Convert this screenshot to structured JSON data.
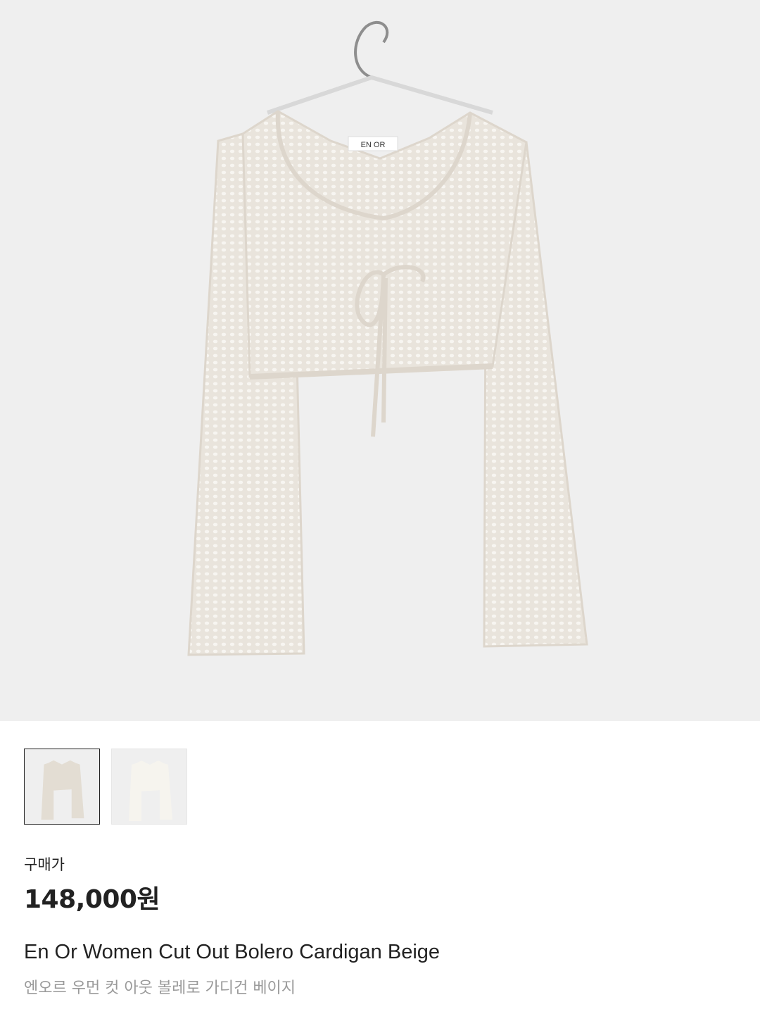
{
  "product": {
    "main_image": "beige crochet bolero cardigan on hanger",
    "label_text": "EN OR",
    "thumbnails": [
      {
        "image": "beige cardigan thumbnail",
        "selected": true
      },
      {
        "image": "ivory cardigan thumbnail",
        "selected": false
      }
    ],
    "price_label": "구매가",
    "price": "148,000원",
    "title_en": "En Or Women Cut Out Bolero Cardigan Beige",
    "title_ko": "엔오르 우먼 컷 아웃 볼레로 가디건 베이지"
  },
  "colors": {
    "hero_background": "#efefef",
    "garment_beige": "#e9e4dc",
    "garment_ivory": "#f6f4ee",
    "text_primary": "#222222",
    "text_secondary": "#9a9a9a",
    "selected_border": "#222222"
  }
}
